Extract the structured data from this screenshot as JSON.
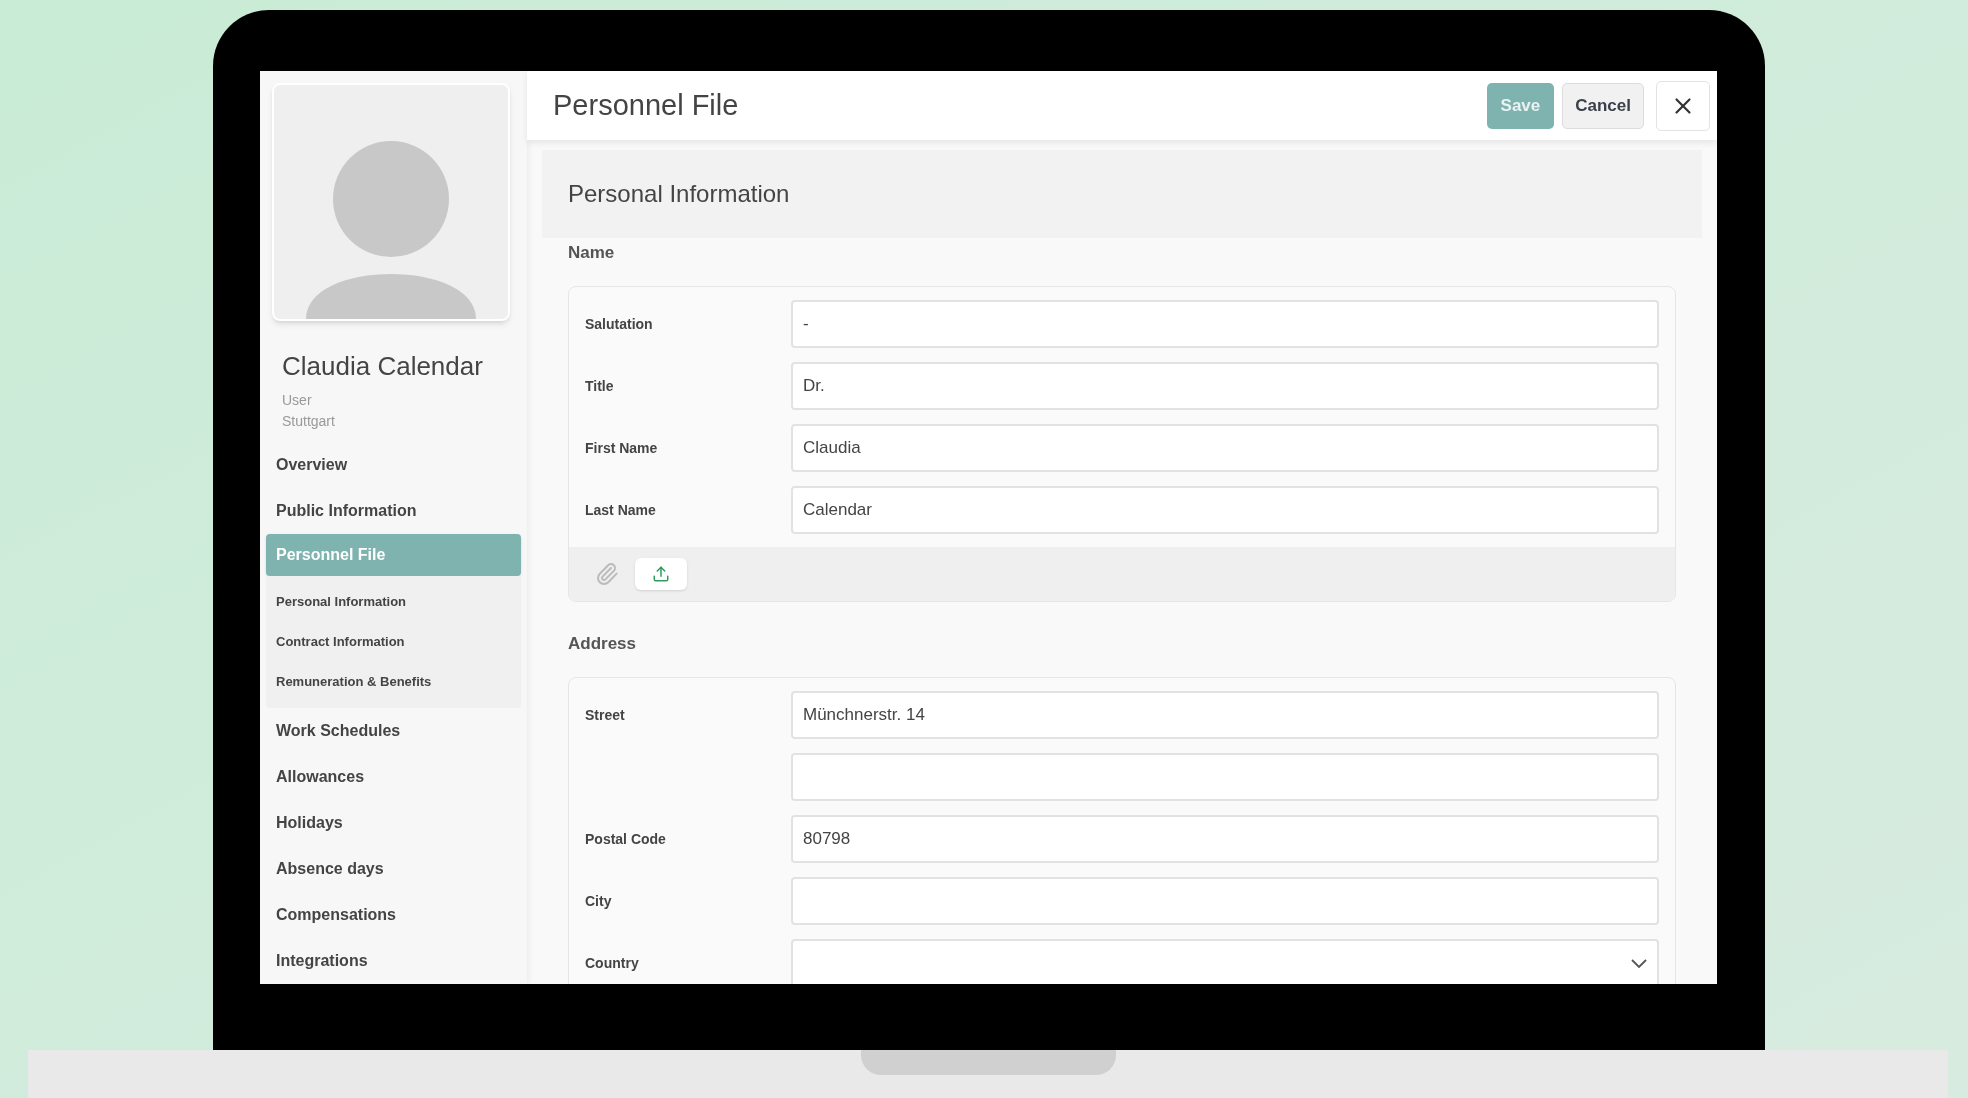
{
  "profile": {
    "name": "Claudia Calendar",
    "role": "User",
    "location": "Stuttgart"
  },
  "nav": [
    {
      "label": "Overview",
      "selected": false
    },
    {
      "label": "Public Information",
      "selected": false
    },
    {
      "label": "Personnel File",
      "selected": true,
      "children": [
        {
          "label": "Personal Information"
        },
        {
          "label": "Contract Information"
        },
        {
          "label": "Remuneration & Benefits"
        }
      ]
    },
    {
      "label": "Work Schedules",
      "selected": false
    },
    {
      "label": "Allowances",
      "selected": false
    },
    {
      "label": "Holidays",
      "selected": false
    },
    {
      "label": "Absence days",
      "selected": false
    },
    {
      "label": "Compensations",
      "selected": false
    },
    {
      "label": "Integrations",
      "selected": false
    }
  ],
  "header": {
    "title": "Personnel File",
    "buttons": [
      {
        "label": "Save",
        "kind": "primary"
      },
      {
        "label": "Cancel",
        "kind": "secondary"
      }
    ]
  },
  "section_title": "Personal Information",
  "groups": [
    {
      "label": "Name",
      "attachments": true,
      "fields": [
        {
          "label": "Salutation",
          "value": "-",
          "kind": "text"
        },
        {
          "label": "Title",
          "value": "Dr.",
          "kind": "text"
        },
        {
          "label": "First Name",
          "value": "Claudia",
          "kind": "text"
        },
        {
          "label": "Last Name",
          "value": "Calendar",
          "kind": "text"
        }
      ]
    },
    {
      "label": "Address",
      "attachments": false,
      "fields": [
        {
          "label": "Street",
          "value": "Münchnerstr. 14",
          "kind": "text"
        },
        {
          "kind": "text"
        },
        {
          "label": "Postal Code",
          "value": "80798",
          "kind": "text"
        },
        {
          "label": "City",
          "kind": "text"
        },
        {
          "label": "Country",
          "kind": "select"
        }
      ]
    }
  ]
}
